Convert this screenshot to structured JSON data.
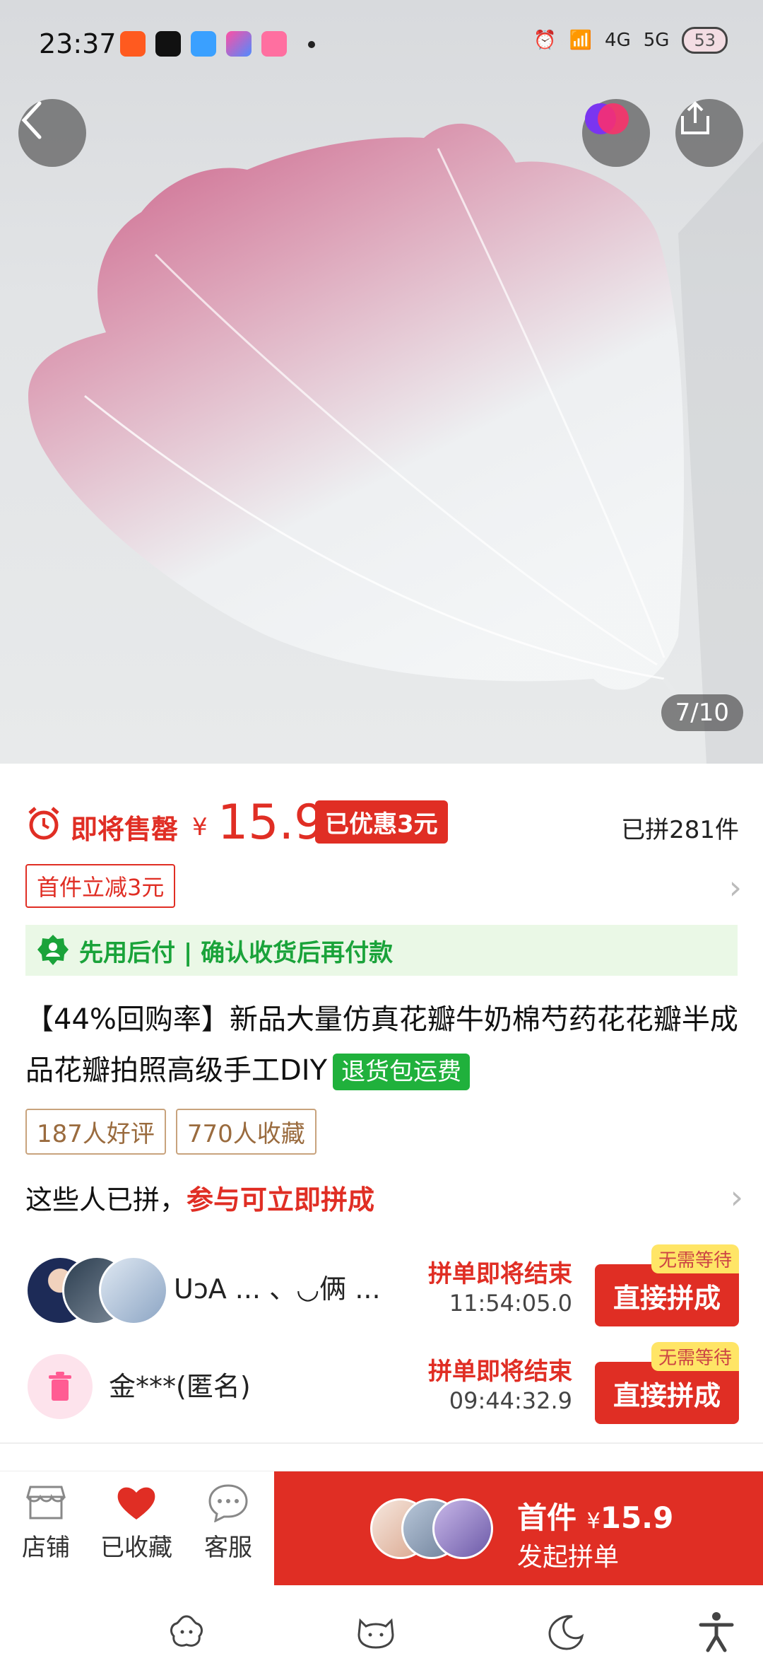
{
  "status_bar": {
    "time": "23:37",
    "network_1": "4G",
    "network_2": "5G",
    "battery": "53"
  },
  "hero": {
    "image_counter": "7/10",
    "back_icon": "back-chevron-icon",
    "share_icon": "share-icon"
  },
  "price": {
    "soon_label": "即将售罄",
    "currency": "¥",
    "amount": "15.9",
    "discount_badge": "已优惠3元",
    "sold_count": "已拼281件"
  },
  "first_item_tag": "首件立减3元",
  "pay_later": {
    "text": "先用后付 | 确认收货后再付款"
  },
  "product_title": "【44%回购率】新品大量仿真花瓣牛奶棉芍药花花瓣半成品花瓣拍照高级手工DIY",
  "return_badge": "退货包运费",
  "stats": {
    "good_reviews": "187人好评",
    "favorites": "770人收藏"
  },
  "group_section": {
    "prefix": "这些人已拼，",
    "highlight": "参与可立即拼成"
  },
  "groups": [
    {
      "names": "UↄA ... 、◡俩 ...",
      "ending_label": "拼单即将结束",
      "timer": "11:54:05.0",
      "badge": "无需等待",
      "button": "直接拼成"
    },
    {
      "names": "金***(匿名)",
      "ending_label": "拼单即将结束",
      "timer": "09:44:32.9",
      "badge": "无需等待",
      "button": "直接拼成"
    }
  ],
  "bottom_bar": {
    "store_label": "店铺",
    "favorited_label": "已收藏",
    "service_label": "客服",
    "cta_line1_prefix": "首件",
    "cta_currency": "¥",
    "cta_price": "15.9",
    "cta_line2": "发起拼单"
  },
  "colors": {
    "brand_red": "#e02e24",
    "green": "#1aa33a",
    "green_badge": "#20b13c",
    "pay_band_bg": "#eaf8e6",
    "stat_border": "#c8a37d"
  }
}
